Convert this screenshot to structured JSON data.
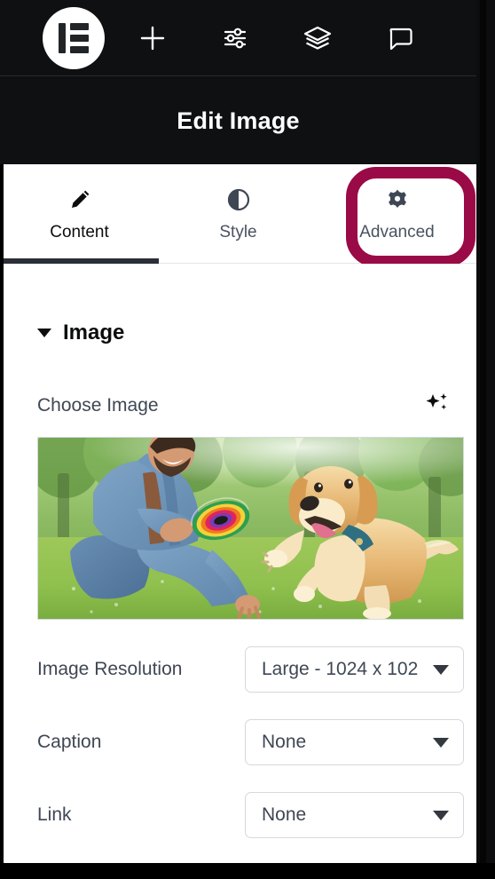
{
  "toolbar": {
    "logo": {
      "name": "elementor-logo",
      "alt": "Elementor"
    },
    "items": [
      {
        "icon": "plus-icon",
        "label": "Add Element"
      },
      {
        "icon": "sliders-icon",
        "label": "Site Settings"
      },
      {
        "icon": "layers-icon",
        "label": "Structure"
      },
      {
        "icon": "comment-icon",
        "label": "Notes"
      }
    ]
  },
  "panel": {
    "title": "Edit Image"
  },
  "tabs": [
    {
      "label": "Content",
      "icon": "pencil-icon",
      "active": true
    },
    {
      "label": "Style",
      "icon": "contrast-icon",
      "active": false
    },
    {
      "label": "Advanced",
      "icon": "gear-icon",
      "active": false,
      "highlighted": true
    }
  ],
  "highlight": {
    "target": "Advanced",
    "color": "#9a0a46"
  },
  "section": {
    "title": "Image",
    "expanded": true,
    "caret": "caret-down-icon"
  },
  "choose_image": {
    "label": "Choose Image",
    "ai_icon": "sparkle-ai-icon",
    "thumbnail_alt": "Man in denim jacket playing frisbee with a golden retriever on sunlit grass"
  },
  "fields": [
    {
      "label": "Image Resolution",
      "value": "Large - 1024 x 102",
      "control": "select"
    },
    {
      "label": "Caption",
      "value": "None",
      "control": "select"
    },
    {
      "label": "Link",
      "value": "None",
      "control": "select"
    }
  ]
}
